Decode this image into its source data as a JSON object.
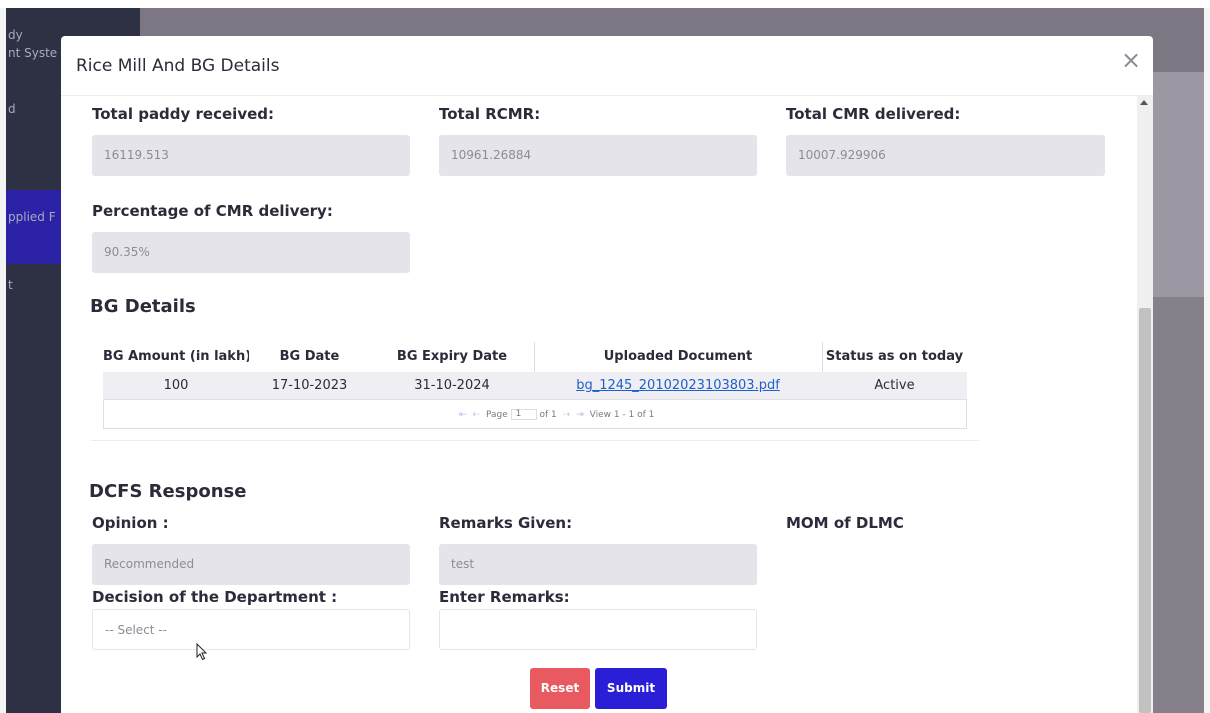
{
  "sidebar": {
    "items": [
      "dy",
      "nt Syste",
      "d",
      "pplied F",
      "t"
    ]
  },
  "modal": {
    "title": "Rice Mill And BG Details",
    "close_label": "×"
  },
  "summary": {
    "total_paddy_label": "Total paddy received:",
    "total_paddy_value": "16119.513",
    "total_rcmr_label": "Total RCMR:",
    "total_rcmr_value": "10961.26884",
    "total_cmr_label": "Total CMR delivered:",
    "total_cmr_value": "10007.929906",
    "percentage_label": "Percentage of CMR delivery:",
    "percentage_value": "90.35%"
  },
  "bg_details": {
    "title": "BG Details",
    "headers": [
      "BG Amount (in lakh)",
      "BG Date",
      "BG Expiry Date",
      "Uploaded Document",
      "Status as on today"
    ],
    "rows": [
      [
        "100",
        "17-10-2023",
        "31-10-2024",
        "bg_1245_20102023103803.pdf",
        "Active"
      ]
    ],
    "pager": {
      "page_label": "Page",
      "page_value": "1",
      "of_label": "of 1",
      "view_label": "View 1 - 1 of 1"
    }
  },
  "dcfs": {
    "title": "DCFS Response",
    "opinion_label": "Opinion :",
    "opinion_value": "Recommended",
    "remarks_label": "Remarks Given:",
    "remarks_value": "test",
    "mom_label": "MOM of DLMC",
    "decision_label": "Decision of the Department :",
    "decision_value": "-- Select --",
    "enter_remarks_label": "Enter Remarks:",
    "enter_remarks_value": ""
  },
  "buttons": {
    "reset": "Reset",
    "submit": "Submit"
  },
  "colors": {
    "sidebar_bg": "#2e3144",
    "sidebar_active": "#2b22a6",
    "overlay": "#85808a",
    "field_bg": "#e4e4ea",
    "reset": "#e85a5f",
    "submit": "#2a1ed6",
    "link": "#1f5fcc"
  }
}
